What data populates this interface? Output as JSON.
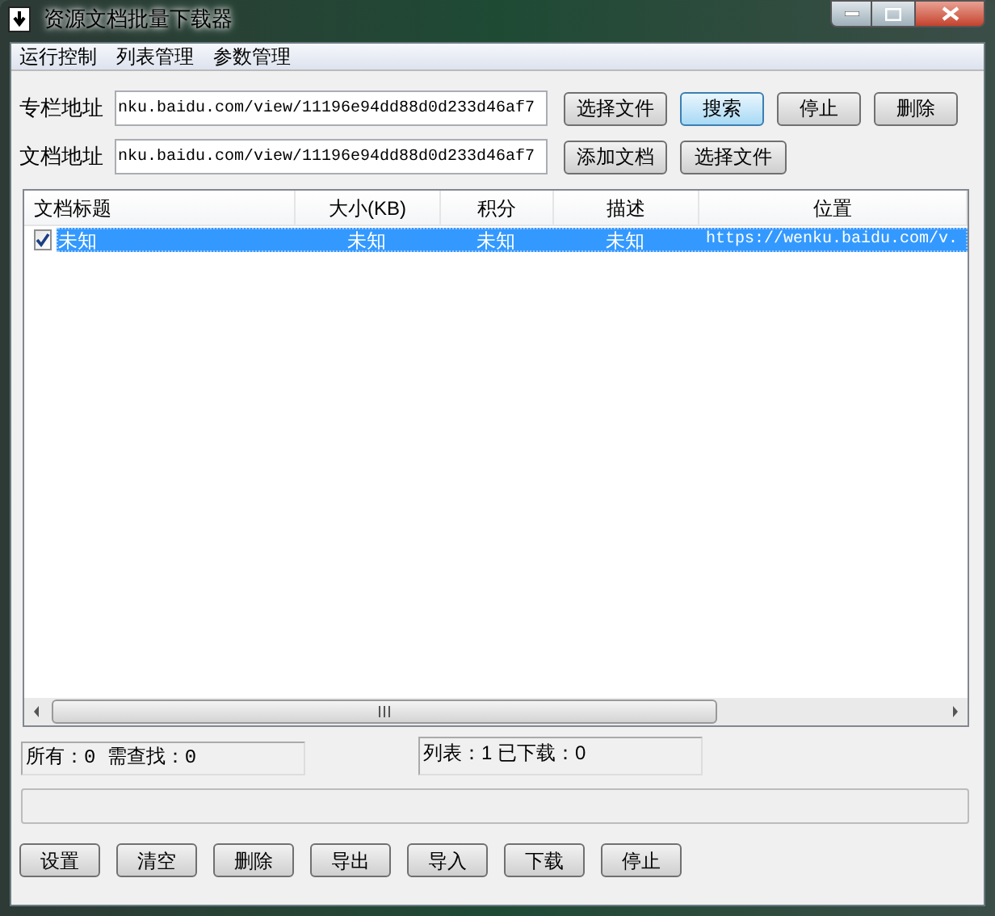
{
  "window": {
    "title": "资源文档批量下载器"
  },
  "menu": [
    {
      "label": "运行控制"
    },
    {
      "label": "列表管理"
    },
    {
      "label": "参数管理"
    }
  ],
  "fields": [
    {
      "label": "专栏地址",
      "value": "nku.baidu.com/view/11196e94dd88d0d233d46af7",
      "buttons": [
        {
          "label": "选择文件",
          "focused": false
        },
        {
          "label": "搜索",
          "focused": true
        },
        {
          "label": "停止",
          "focused": false
        },
        {
          "label": "删除",
          "focused": false
        }
      ]
    },
    {
      "label": "文档地址",
      "value": "nku.baidu.com/view/11196e94dd88d0d233d46af7",
      "buttons": [
        {
          "label": "添加文档",
          "focused": false
        },
        {
          "label": "选择文件",
          "focused": false
        }
      ]
    }
  ],
  "table": {
    "columns": [
      "文档标题",
      "大小(KB)",
      "积分",
      "描述",
      "位置"
    ],
    "rows": [
      {
        "checked": true,
        "selected": true,
        "cells": [
          "未知",
          "未知",
          "未知",
          "未知",
          "https://wenku.baidu.com/v."
        ]
      }
    ]
  },
  "status": [
    "所有：0 需查找：0",
    "列表：1 已下载：0"
  ],
  "buttons": [
    "设置",
    "清空",
    "删除",
    "导出",
    "导入",
    "下载",
    "停止"
  ]
}
